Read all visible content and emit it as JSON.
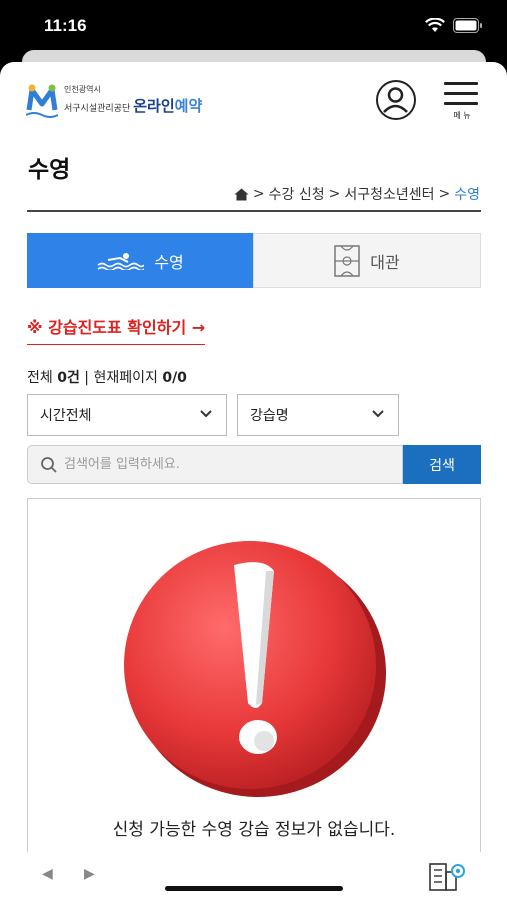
{
  "status_bar": {
    "time": "11:16"
  },
  "header": {
    "logo_line1": "인천광역시",
    "logo_line2": "서구시설관리공단",
    "logo_brand_1": "온라인",
    "logo_brand_2": "예약",
    "menu_label": "메 뉴"
  },
  "page": {
    "title": "수영",
    "breadcrumb": [
      "수강 신청",
      "서구청소년센터",
      "수영"
    ],
    "breadcrumb_sep": ">"
  },
  "tabs": [
    {
      "label": "수영",
      "active": true
    },
    {
      "label": "대관",
      "active": false
    }
  ],
  "notice_link": "※ 강습진도표 확인하기 →",
  "counts": {
    "total_label": "전체",
    "total_value": "0건",
    "page_label": "현재페이지",
    "page_value": "0/0"
  },
  "filters": {
    "time_select": "시간전체",
    "class_select": "강습명"
  },
  "search": {
    "placeholder": "검색어를 입력하세요.",
    "button_label": "검색"
  },
  "empty_message": "신청 가능한 수영 강습 정보가 없습니다.",
  "colors": {
    "accent": "#2f83e8",
    "search_button": "#1c6fbf",
    "notice": "#e0201f",
    "alert": "#e8393a"
  }
}
